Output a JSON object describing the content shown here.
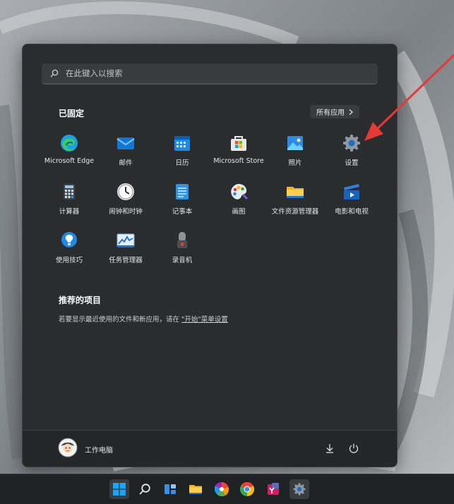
{
  "search": {
    "placeholder": "在此键入以搜索"
  },
  "pinned": {
    "title": "已固定",
    "all_apps_label": "所有应用",
    "apps": [
      {
        "label": "Microsoft Edge",
        "icon": "edge-icon"
      },
      {
        "label": "邮件",
        "icon": "mail-icon"
      },
      {
        "label": "日历",
        "icon": "calendar-icon"
      },
      {
        "label": "Microsoft Store",
        "icon": "store-icon"
      },
      {
        "label": "照片",
        "icon": "photos-icon"
      },
      {
        "label": "设置",
        "icon": "settings-gear-icon"
      },
      {
        "label": "计算器",
        "icon": "calculator-icon"
      },
      {
        "label": "闹钟和时钟",
        "icon": "clock-icon"
      },
      {
        "label": "记事本",
        "icon": "notepad-icon"
      },
      {
        "label": "画图",
        "icon": "paint-palette-icon"
      },
      {
        "label": "文件资源管理器",
        "icon": "folder-icon"
      },
      {
        "label": "电影和电视",
        "icon": "movies-tv-icon"
      },
      {
        "label": "使用技巧",
        "icon": "tips-bulb-icon"
      },
      {
        "label": "任务管理器",
        "icon": "task-manager-icon"
      },
      {
        "label": "录音机",
        "icon": "microphone-icon"
      }
    ]
  },
  "recommended": {
    "title": "推荐的项目",
    "text_prefix": "若要显示最近使用的文件和新应用，请在 ",
    "link_text": "\"开始\"菜单设置"
  },
  "footer": {
    "user_name": "工作电脑"
  },
  "taskbar": {
    "icons": [
      "windows-start-icon",
      "search-icon",
      "widgets-icon",
      "file-explorer-icon",
      "colorful-app-icon",
      "chrome-icon",
      "red-app-icon",
      "settings-gear-icon"
    ]
  },
  "colors": {
    "accent_arrow": "#e53935",
    "menu_bg": "#2b2c2e"
  }
}
